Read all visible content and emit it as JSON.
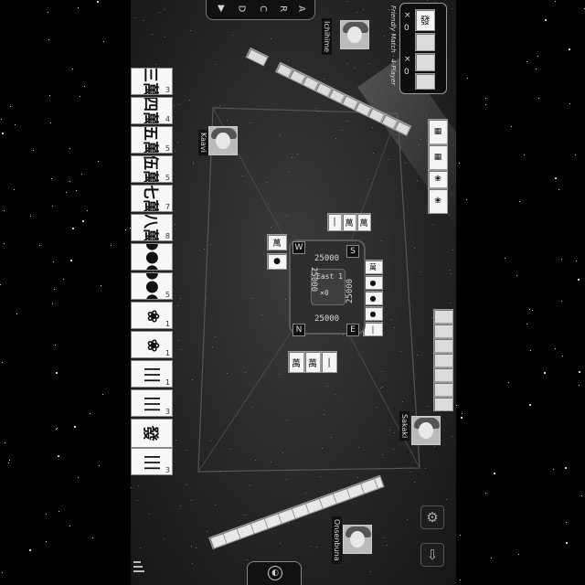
{
  "top_bar": {
    "buttons": [
      "A",
      "R",
      "C",
      "D"
    ],
    "menu_icon": "triangle-down-icon"
  },
  "rule_panel": {
    "title": "Friendly Match · 4-Player",
    "counters": [
      "0",
      "0"
    ],
    "multipliers": [
      "×",
      "×"
    ]
  },
  "players": {
    "top": {
      "name": "Ichihime"
    },
    "left": {
      "name": "Kaavi"
    },
    "right": {
      "name": "Sakaki"
    },
    "bottom": {
      "name": "Onsenbuna"
    }
  },
  "center": {
    "scores": {
      "self": "25000",
      "right": "25000",
      "top": "25000",
      "left": "25000"
    },
    "info_top": "East 1",
    "info_bottom": "×0",
    "winds": {
      "self": "E",
      "right": "S",
      "top": "W",
      "left": "N"
    }
  },
  "hand": [
    {
      "glyph": "三萬",
      "num": "3"
    },
    {
      "glyph": "四萬",
      "num": "4"
    },
    {
      "glyph": "五萬",
      "num": "5"
    },
    {
      "glyph": "伍萬",
      "num": "5"
    },
    {
      "glyph": "七萬",
      "num": "7"
    },
    {
      "glyph": "八萬",
      "num": "8"
    },
    {
      "glyph": "●●●",
      "num": ""
    },
    {
      "glyph": "●●●",
      "num": "5"
    },
    {
      "glyph": "❀",
      "num": "1"
    },
    {
      "glyph": "❀",
      "num": "1"
    },
    {
      "glyph": "|||",
      "num": "1"
    },
    {
      "glyph": "|||",
      "num": "3"
    },
    {
      "glyph": "發",
      "num": ""
    },
    {
      "glyph": "|||",
      "num": "3"
    }
  ],
  "bottom_bar": {
    "icon": "emoji-icon"
  },
  "side_buttons": {
    "settings_icon": "gear-icon",
    "download_icon": "download-icon"
  },
  "left_menu_icon": "menu-icon"
}
